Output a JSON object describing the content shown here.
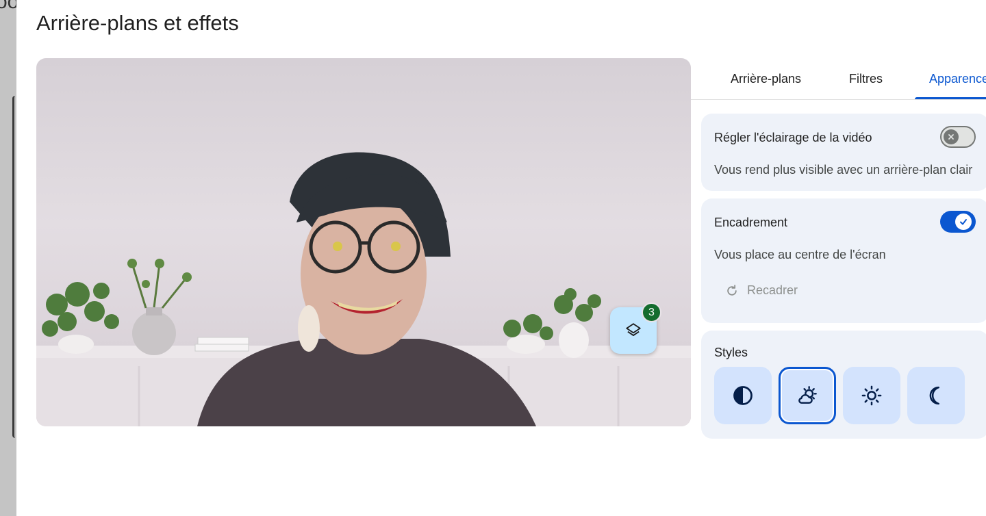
{
  "background": {
    "fragment_text": "oo"
  },
  "dialog": {
    "title": "Arrière-plans et effets"
  },
  "preview": {
    "effects_badge_count": "3"
  },
  "tabs": [
    {
      "label": "Arrière-plans",
      "active": false
    },
    {
      "label": "Filtres",
      "active": false
    },
    {
      "label": "Apparence",
      "active": true
    }
  ],
  "lighting": {
    "title": "Régler l'éclairage de la vidéo",
    "description": "Vous rend plus visible avec un arrière-plan clair",
    "enabled": false
  },
  "framing": {
    "title": "Encadrement",
    "description": "Vous place au centre de l'écran",
    "enabled": true,
    "reframe_label": "Recadrer"
  },
  "styles": {
    "title": "Styles",
    "options": [
      {
        "icon": "contrast-icon",
        "selected": false
      },
      {
        "icon": "partly-cloudy-icon",
        "selected": true
      },
      {
        "icon": "sun-icon",
        "selected": false
      },
      {
        "icon": "moon-icon",
        "selected": false
      }
    ]
  },
  "colors": {
    "accent": "#0b57d0",
    "badge": "#146c2e",
    "card_background": "#eef2f9",
    "style_button": "#d3e3fd"
  }
}
